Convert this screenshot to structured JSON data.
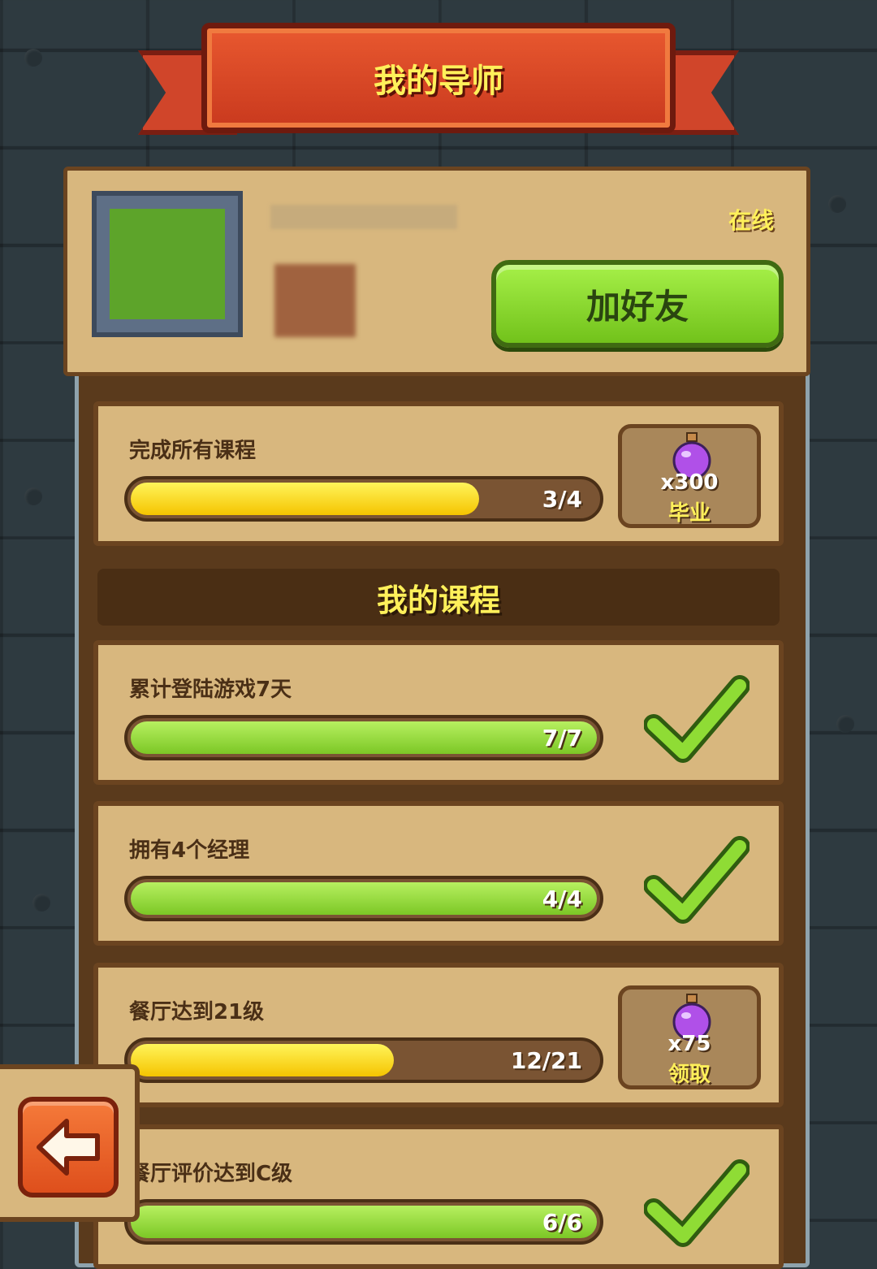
{
  "header": {
    "title": "我的导师"
  },
  "mentor": {
    "status": "在线",
    "add_friend_label": "加好友"
  },
  "graduation": {
    "label": "完成所有课程",
    "progress_text": "3/4",
    "progress": 0.75,
    "reward_qty": "x300",
    "reward_action": "毕业"
  },
  "courses_section": {
    "title": "我的课程"
  },
  "courses": [
    {
      "label": "累计登陆游戏7天",
      "progress_text": "7/7",
      "progress": 1.0,
      "status": "complete"
    },
    {
      "label": "拥有4个经理",
      "progress_text": "4/4",
      "progress": 1.0,
      "status": "complete"
    },
    {
      "label": "餐厅达到21级",
      "progress_text": "12/21",
      "progress": 0.571,
      "status": "claimable",
      "reward_qty": "x75",
      "reward_action": "领取"
    },
    {
      "label": "餐厅评价达到C级",
      "progress_text": "6/6",
      "progress": 1.0,
      "status": "complete"
    }
  ],
  "colors": {
    "title_yellow": "#fff05a",
    "progress_yellow": "#f5c400",
    "progress_green": "#7cc726",
    "panel_tan": "#d8b77e",
    "banner_red": "#d0452a"
  },
  "icons": [
    "potion-icon",
    "checkmark-icon",
    "back-arrow-icon"
  ]
}
